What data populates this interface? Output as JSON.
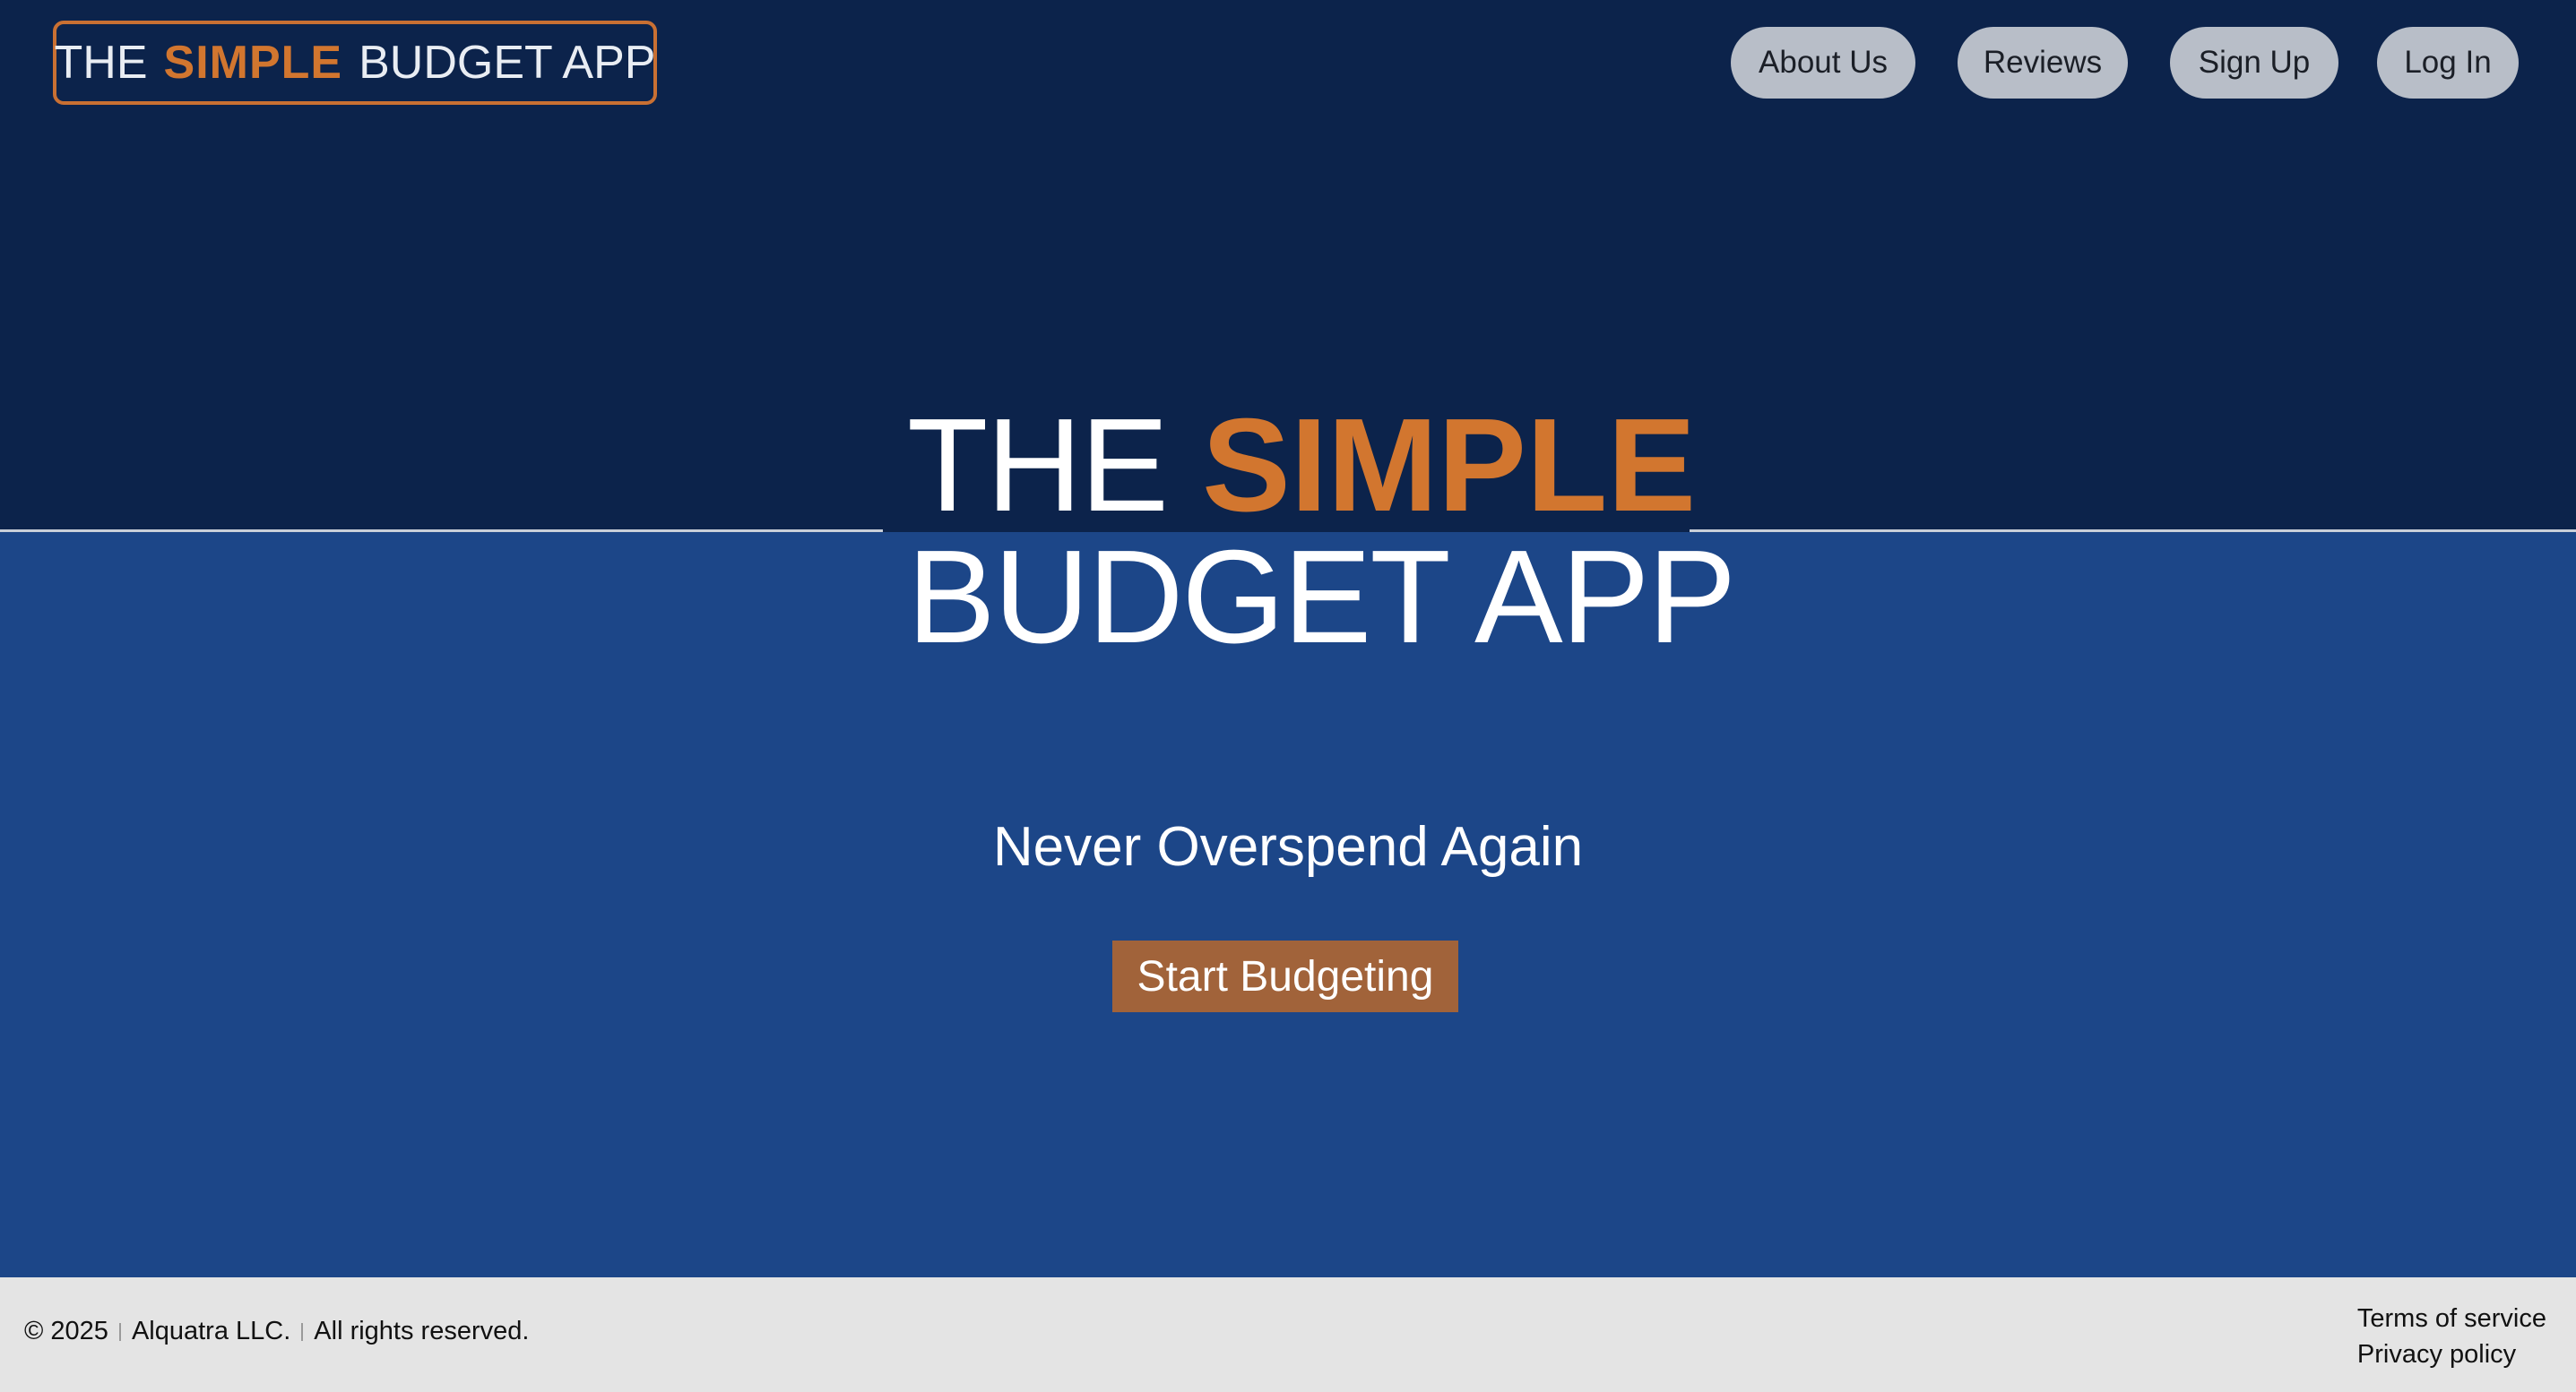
{
  "header": {
    "logo": {
      "pre": "THE",
      "accent": "SIMPLE",
      "post": "BUDGET APP"
    },
    "nav": [
      {
        "label": "About Us"
      },
      {
        "label": "Reviews"
      },
      {
        "label": "Sign Up"
      },
      {
        "label": "Log In"
      }
    ]
  },
  "hero": {
    "title_pre": "THE",
    "title_accent": "SIMPLE",
    "title_line2": "BUDGET APP",
    "tagline": "Never Overspend Again",
    "cta_label": "Start Budgeting"
  },
  "footer": {
    "copyright_parts": [
      "© 2025",
      "Alquatra LLC.",
      "All rights reserved."
    ],
    "links": [
      {
        "label": "Terms of service"
      },
      {
        "label": "Privacy policy"
      }
    ]
  },
  "colors": {
    "dark_navy": "#0c234b",
    "blue": "#1c4688",
    "accent_orange": "#d2762f",
    "cta_brown": "#a1633a",
    "nav_pill": "#b8bec8",
    "footer_bg": "#e4e4e4"
  }
}
